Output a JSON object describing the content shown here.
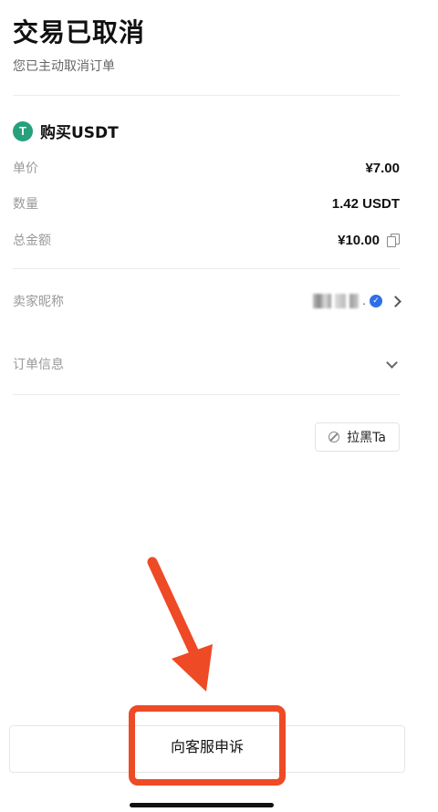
{
  "header": {
    "title": "交易已取消",
    "subtitle": "您已主动取消订单"
  },
  "asset": {
    "icon": "usdt-tether-icon",
    "icon_glyph": "T",
    "label": "购买USDT"
  },
  "details": {
    "unit_price_label": "单价",
    "unit_price_value": "¥7.00",
    "quantity_label": "数量",
    "quantity_value": "1.42 USDT",
    "total_label": "总金额",
    "total_value": "¥10.00"
  },
  "seller": {
    "label": "卖家昵称",
    "name_dot": ".",
    "verified_glyph": "✓"
  },
  "order_info": {
    "label": "订单信息"
  },
  "actions": {
    "block_label": "拉黑Ta",
    "appeal_label": "向客服申诉"
  },
  "colors": {
    "usdt_green": "#26a17b",
    "annotation_red": "#ee4a25",
    "verified_blue": "#2f6fe6"
  }
}
